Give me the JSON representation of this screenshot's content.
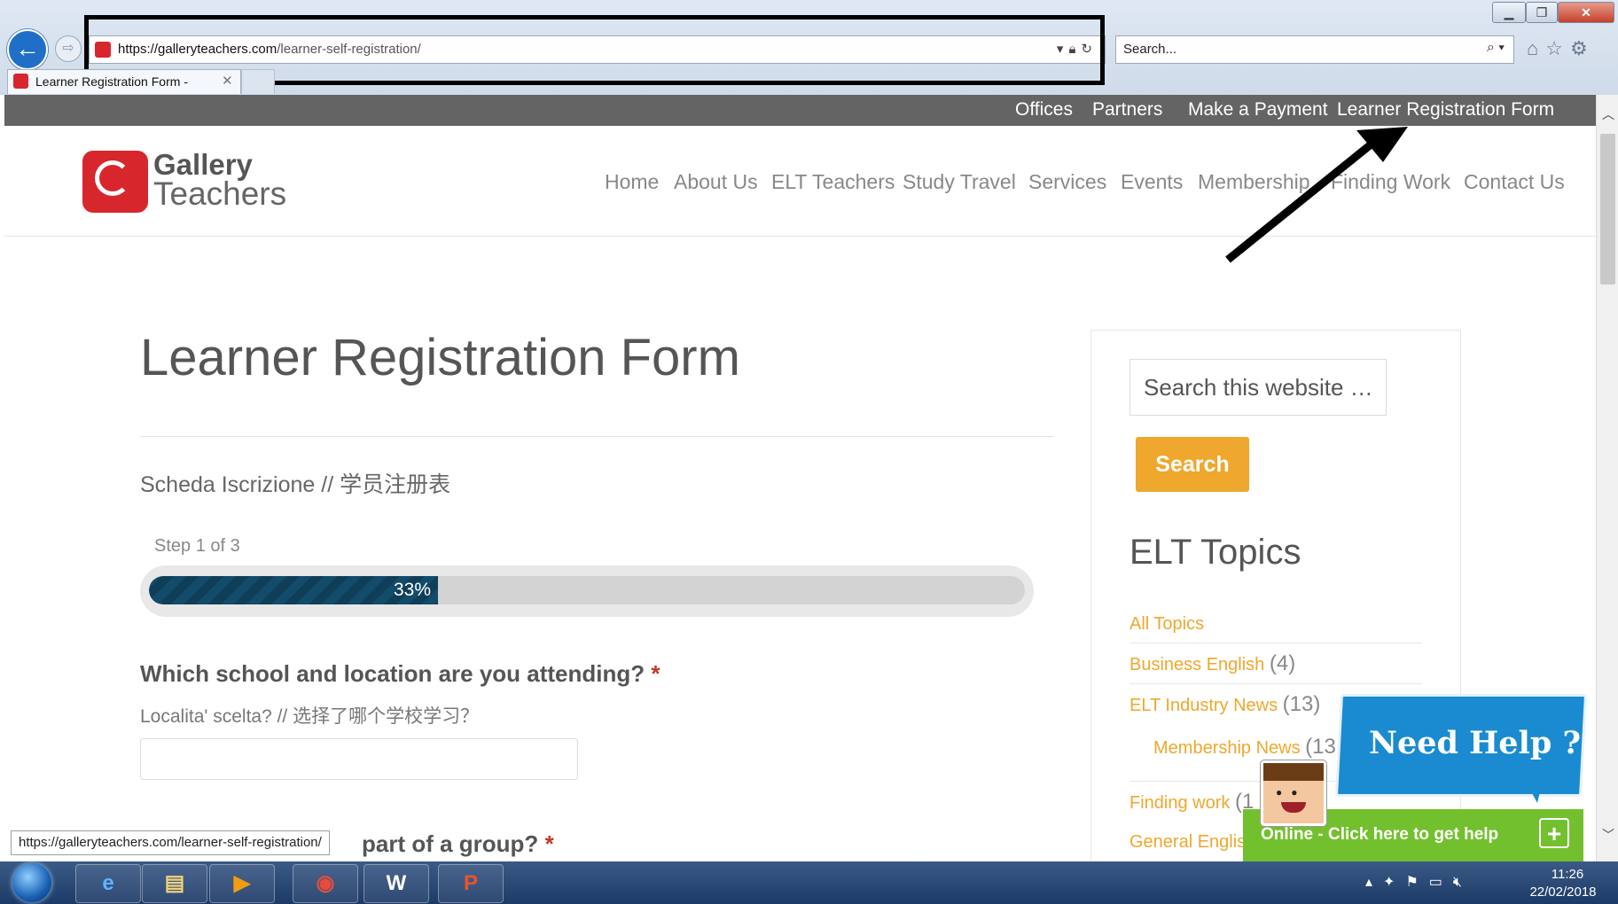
{
  "browser": {
    "url_host": "https://galleryteachers.com",
    "url_path": "/learner-self-registration/",
    "search_placeholder": "Search...",
    "tab_title": "Learner Registration Form -",
    "status_url": "https://galleryteachers.com/learner-self-registration/"
  },
  "topbar": {
    "links": [
      "Offices",
      "Partners",
      "Make a Payment",
      "Learner Registration Form"
    ]
  },
  "site": {
    "logo_line1": "Gallery",
    "logo_line2": "Teachers",
    "nav": [
      "Home",
      "About Us",
      "ELT Teachers",
      "Study Travel",
      "Services",
      "Events",
      "Membership",
      "Finding Work",
      "Contact Us"
    ]
  },
  "page": {
    "title": "Learner Registration Form",
    "subtitle": "Scheda Iscrizione // 学员注册表",
    "step_label": "Step 1 of 3",
    "progress_percent": 33,
    "progress_label": "33%",
    "q1_label": "Which school and location are you attending?",
    "q1_required": "*",
    "q1_sub": "Localita' scelta? // 选择了哪个学校学习？",
    "q2_label": "part of a group?",
    "q2_required": "*"
  },
  "sidebar": {
    "search_placeholder": "Search this website …",
    "search_button": "Search",
    "topics_title": "ELT Topics",
    "topics": [
      {
        "label": "All Topics",
        "count": ""
      },
      {
        "label": "Business English",
        "count": "(4)"
      },
      {
        "label": "ELT Industry News",
        "count": "(13)"
      },
      {
        "label": "Membership News",
        "count": "(13"
      },
      {
        "label": "Finding work",
        "count": "(1"
      },
      {
        "label": "General Englis",
        "count": ""
      }
    ]
  },
  "help_widget": {
    "title": "Need Help ?",
    "bar_text": "Online - Click here to get help",
    "plus": "+"
  },
  "taskbar": {
    "time": "11:26",
    "date": "22/02/2018"
  },
  "colors": {
    "brand_red": "#d8262d",
    "topbar_gray": "#646464",
    "accent_orange": "#efa72d",
    "progress_blue": "#134b6a",
    "help_blue": "#1a8bd0",
    "help_green": "#73c02e"
  }
}
